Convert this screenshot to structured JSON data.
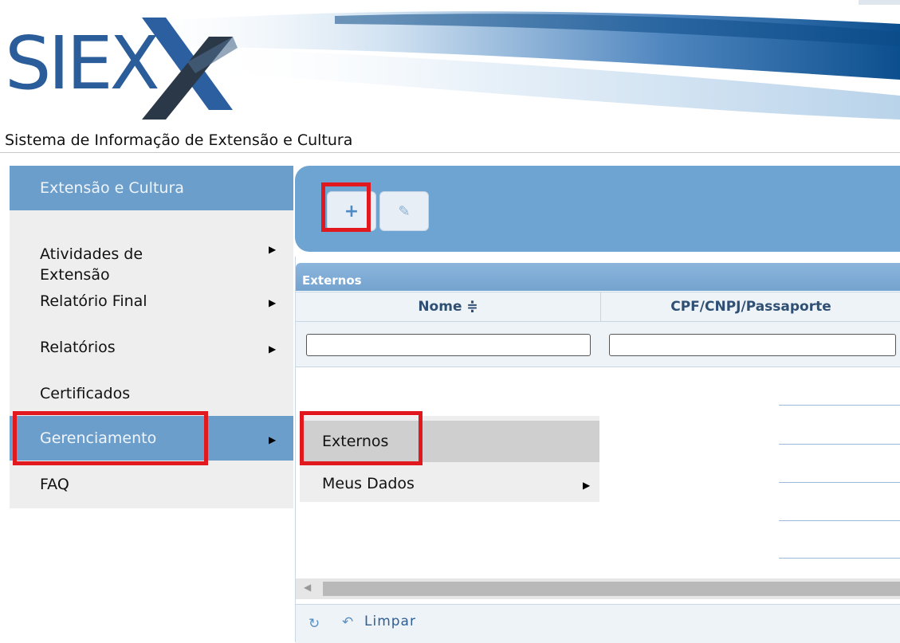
{
  "header": {
    "logo_text": "SIEX",
    "subtitle": "Sistema de Informação de Extensão e Cultura"
  },
  "sidebar": {
    "title": "Extensão e Cultura",
    "items": [
      {
        "label": "Atividades de\nExtensão",
        "has_submenu": true
      },
      {
        "label": "Relatório Final",
        "has_submenu": true
      },
      {
        "label": "Relatórios",
        "has_submenu": true
      },
      {
        "label": "Certificados",
        "has_submenu": false
      },
      {
        "label": "Gerenciamento",
        "has_submenu": true,
        "active": true
      },
      {
        "label": "FAQ",
        "has_submenu": false
      }
    ]
  },
  "submenu": {
    "items": [
      {
        "label": "Externos",
        "hover": true
      },
      {
        "label": "Meus Dados",
        "has_submenu": true
      }
    ]
  },
  "toolbar": {
    "add_icon": "plus-icon",
    "edit_icon": "pencil-icon"
  },
  "grid": {
    "caption": "Externos",
    "columns": [
      "Nome ≑",
      "CPF/CNPJ/Passaporte"
    ],
    "footer": {
      "refresh_icon": "refresh-icon",
      "undo_icon": "undo-icon",
      "clear_label": "Limpar"
    }
  },
  "colors": {
    "accent": "#6b9ecb",
    "highlight": "#e1191f"
  }
}
